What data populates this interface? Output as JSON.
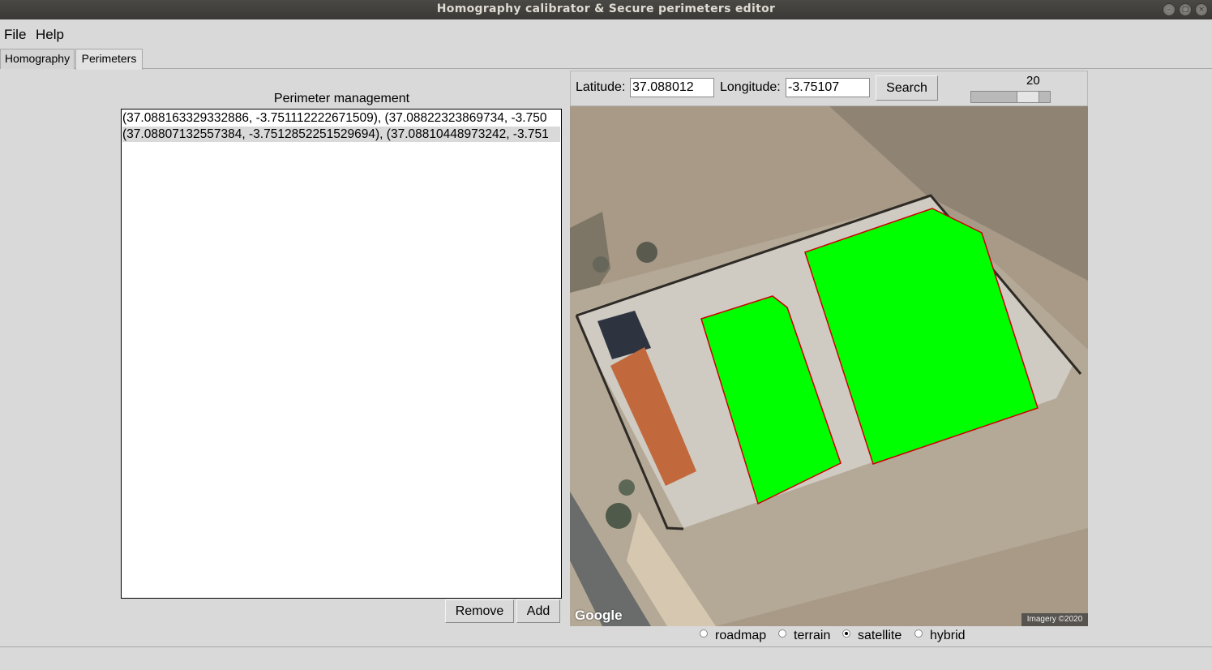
{
  "window": {
    "title": "Homography calibrator & Secure perimeters editor"
  },
  "menu": {
    "file": "File",
    "help": "Help"
  },
  "tabs": [
    {
      "label": "Homography",
      "active": false
    },
    {
      "label": "Perimeters",
      "active": true
    }
  ],
  "perimeters": {
    "title": "Perimeter management",
    "items": [
      "(37.088163329332886, -3.751112222671509), (37.08822323869734, -3.750",
      "(37.08807132557384, -3.7512852251529694), (37.08810448973242, -3.751"
    ],
    "selected_index": 1,
    "remove_label": "Remove",
    "add_label": "Add"
  },
  "map": {
    "latitude_label": "Latitude:",
    "latitude_value": "37.088012",
    "longitude_label": "Longitude:",
    "longitude_value": "-3.75107",
    "search_label": "Search",
    "zoom": 20,
    "zoom_fraction": 0.8,
    "google_logo": "Google",
    "attribution": "Imagery ©2020",
    "perimeter_fill_color": "#00ff00",
    "perimeter_stroke_color": "#cc0000",
    "map_types": [
      {
        "label": "roadmap",
        "selected": false
      },
      {
        "label": "terrain",
        "selected": false
      },
      {
        "label": "satellite",
        "selected": true
      },
      {
        "label": "hybrid",
        "selected": false
      }
    ]
  }
}
